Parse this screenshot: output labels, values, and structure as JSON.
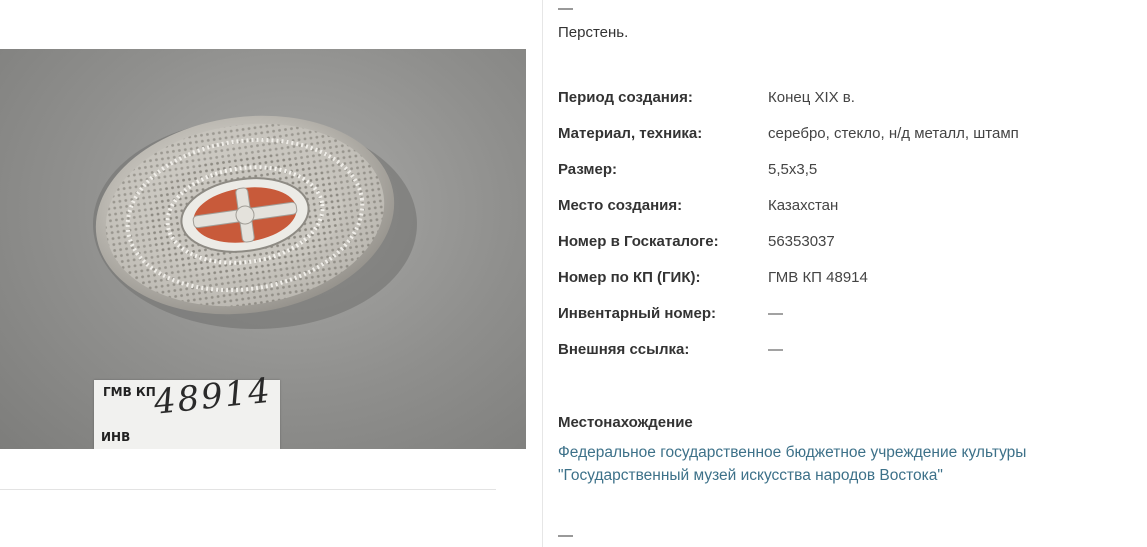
{
  "header_dash": "—",
  "item_title": "Перстень.",
  "photo": {
    "label_kp": "ГМВ КП",
    "label_number": "48914",
    "label_inv": "ИНВ"
  },
  "properties": [
    {
      "key": "Период создания:",
      "value": "Конец XIX в."
    },
    {
      "key": "Материал, техника:",
      "value": "серебро, стекло, н/д металл, штамп"
    },
    {
      "key": "Размер:",
      "value": "5,5х3,5"
    },
    {
      "key": "Место создания:",
      "value": "Казахстан"
    },
    {
      "key": "Номер в Госкаталоге:",
      "value": "56353037"
    },
    {
      "key": "Номер по КП (ГИК):",
      "value": "ГМВ КП 48914"
    },
    {
      "key": "Инвентарный номер:",
      "value": "—"
    },
    {
      "key": "Внешняя ссылка:",
      "value": "—"
    }
  ],
  "location": {
    "heading": "Местонахождение",
    "line1": "Федеральное государственное бюджетное учреждение культуры",
    "line2": "\"Государственный музей искусства народов Востока\""
  },
  "footer_dash": "—",
  "colors": {
    "link": "#3d7189",
    "text": "#333333"
  }
}
